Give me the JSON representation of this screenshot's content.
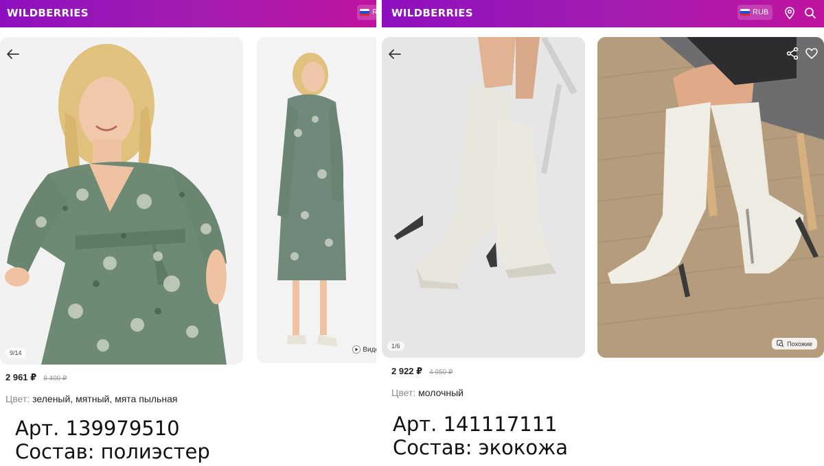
{
  "left": {
    "brand": "WILDBERRIES",
    "currency_partial": "R",
    "main_photo": {
      "counter": "9/14"
    },
    "side_photo": {
      "video_label": "Виде"
    },
    "price": "2 961 ₽",
    "old_price": "8 400 ₽",
    "color_label": "Цвет:",
    "color_value": "зеленый, мятный, мята пыльная",
    "article": "Арт. 139979510",
    "composition": "Состав: полиэстер"
  },
  "right": {
    "brand": "WILDBERRIES",
    "currency": "RUB",
    "main_photo": {
      "counter": "1/6"
    },
    "side_photo": {
      "similar_label": "Похожие"
    },
    "price": "2 922 ₽",
    "old_price": "4 950 ₽",
    "color_label": "Цвет:",
    "color_value": "молочный",
    "article": "Арт. 141117111",
    "composition": "Состав: экокожа"
  },
  "icons": {
    "back": "back-arrow-icon",
    "location": "location-pin-icon",
    "search": "search-icon",
    "share": "share-icon",
    "favorite": "heart-icon",
    "play": "play-icon",
    "similar": "similar-icon",
    "flag": "russia-flag-icon"
  },
  "colors": {
    "header_start": "#8e0fbf",
    "header_end": "#c0139f",
    "price": "#222222",
    "muted": "#8c8c8c"
  }
}
